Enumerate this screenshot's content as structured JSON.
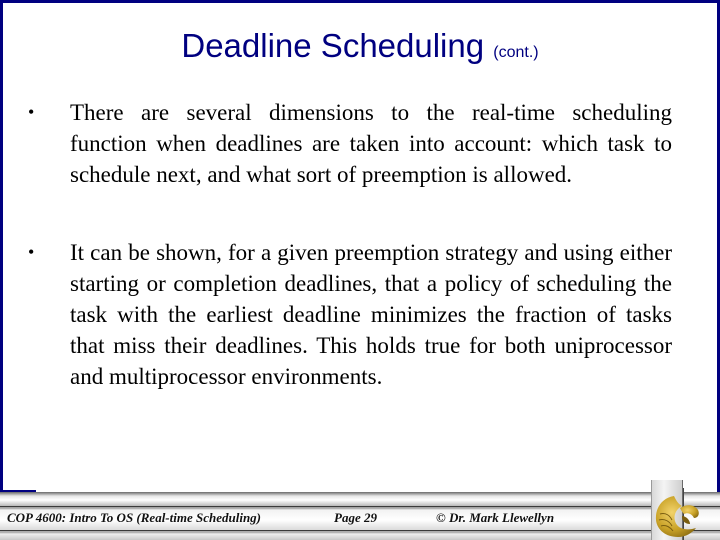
{
  "slide": {
    "title": "Deadline Scheduling",
    "title_suffix": "(cont.)",
    "bullets": [
      {
        "marker": "•",
        "text": "There are several dimensions to the real-time scheduling function when deadlines are taken into account:  which task to schedule next, and what sort of preemption is allowed."
      },
      {
        "marker": "•",
        "text": "It can be shown, for a given preemption strategy and using either starting or completion deadlines, that a policy of scheduling the task with the earliest deadline minimizes the fraction of tasks that miss their deadlines.  This holds true for both uniprocessor and multiprocessor environments."
      }
    ]
  },
  "footer": {
    "course": "COP 4600: Intro To OS  (Real-time Scheduling)",
    "page": "Page 29",
    "copyright": "© Dr. Mark Llewellyn",
    "logo_icon": "ucf-pegasus-logo"
  },
  "colors": {
    "title": "#000080",
    "border": "#000080",
    "body_text": "#000000",
    "logo_gold": "#C9A227"
  }
}
